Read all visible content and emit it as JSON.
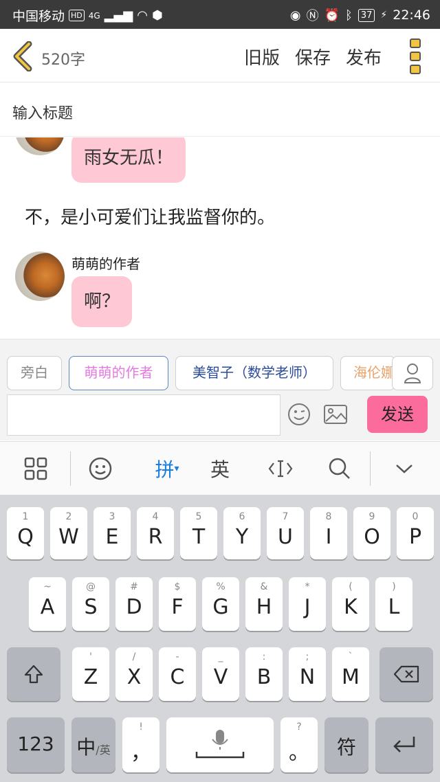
{
  "status_bar": {
    "carrier": "中国移动",
    "hd": "HD",
    "network": "4G",
    "battery": "37",
    "time": "22:46"
  },
  "header": {
    "word_count": "520字",
    "old_version": "旧版",
    "save": "保存",
    "publish": "发布"
  },
  "title_input": {
    "placeholder": "输入标题"
  },
  "content": {
    "bubble_top": "雨女无瓜！",
    "narration": "不，是小可爱们让我监督你的。",
    "speaker": "萌萌的作者",
    "bubble_bottom": "啊？"
  },
  "characters": [
    {
      "label": "旁白",
      "color": "#888888"
    },
    {
      "label": "萌萌的作者",
      "color": "#e47ae0"
    },
    {
      "label": "美智子（数学老师）",
      "color": "#2a4b9b"
    },
    {
      "label": "海伦娜",
      "color": "#e8a26a"
    }
  ],
  "composer": {
    "send": "发送"
  },
  "keyboard_toolbar": {
    "pinyin": "拼",
    "english": "英"
  },
  "keyboard": {
    "row1": [
      {
        "sub": "1",
        "key": "Q"
      },
      {
        "sub": "2",
        "key": "W"
      },
      {
        "sub": "3",
        "key": "E"
      },
      {
        "sub": "4",
        "key": "R"
      },
      {
        "sub": "5",
        "key": "T"
      },
      {
        "sub": "6",
        "key": "Y"
      },
      {
        "sub": "7",
        "key": "U"
      },
      {
        "sub": "8",
        "key": "I"
      },
      {
        "sub": "9",
        "key": "O"
      },
      {
        "sub": "0",
        "key": "P"
      }
    ],
    "row2": [
      {
        "sub": "~",
        "key": "A"
      },
      {
        "sub": "@",
        "key": "S"
      },
      {
        "sub": "#",
        "key": "D"
      },
      {
        "sub": "$",
        "key": "F"
      },
      {
        "sub": "%",
        "key": "G"
      },
      {
        "sub": "&",
        "key": "H"
      },
      {
        "sub": "*",
        "key": "J"
      },
      {
        "sub": "(",
        "key": "K"
      },
      {
        "sub": ")",
        "key": "L"
      }
    ],
    "row3": [
      {
        "sub": "'",
        "key": "Z"
      },
      {
        "sub": "/",
        "key": "X"
      },
      {
        "sub": "-",
        "key": "C"
      },
      {
        "sub": "_",
        "key": "V"
      },
      {
        "sub": ":",
        "key": "B"
      },
      {
        "sub": ";",
        "key": "N"
      },
      {
        "sub": "`",
        "key": "M"
      }
    ],
    "numbers_key": "123",
    "lang_key_main": "中",
    "lang_key_sub": "/英",
    "punct_sub": "!",
    "punct_main": "，",
    "period_sub": "?",
    "period_main": "。",
    "symbols_key": "符"
  }
}
